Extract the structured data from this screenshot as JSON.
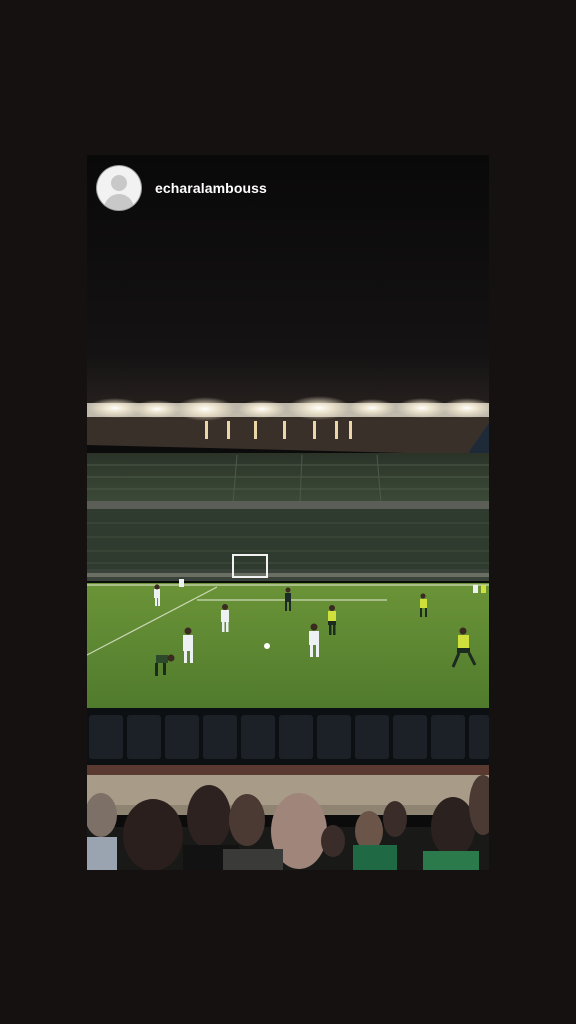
{
  "story": {
    "username": "echaralambouss",
    "avatar_icon": "default-user-avatar-icon"
  },
  "colors": {
    "background": "#141110",
    "pitch": "#5f8a34",
    "home_kit": "#e8ecef",
    "away_kit": "#c9dd3a"
  }
}
